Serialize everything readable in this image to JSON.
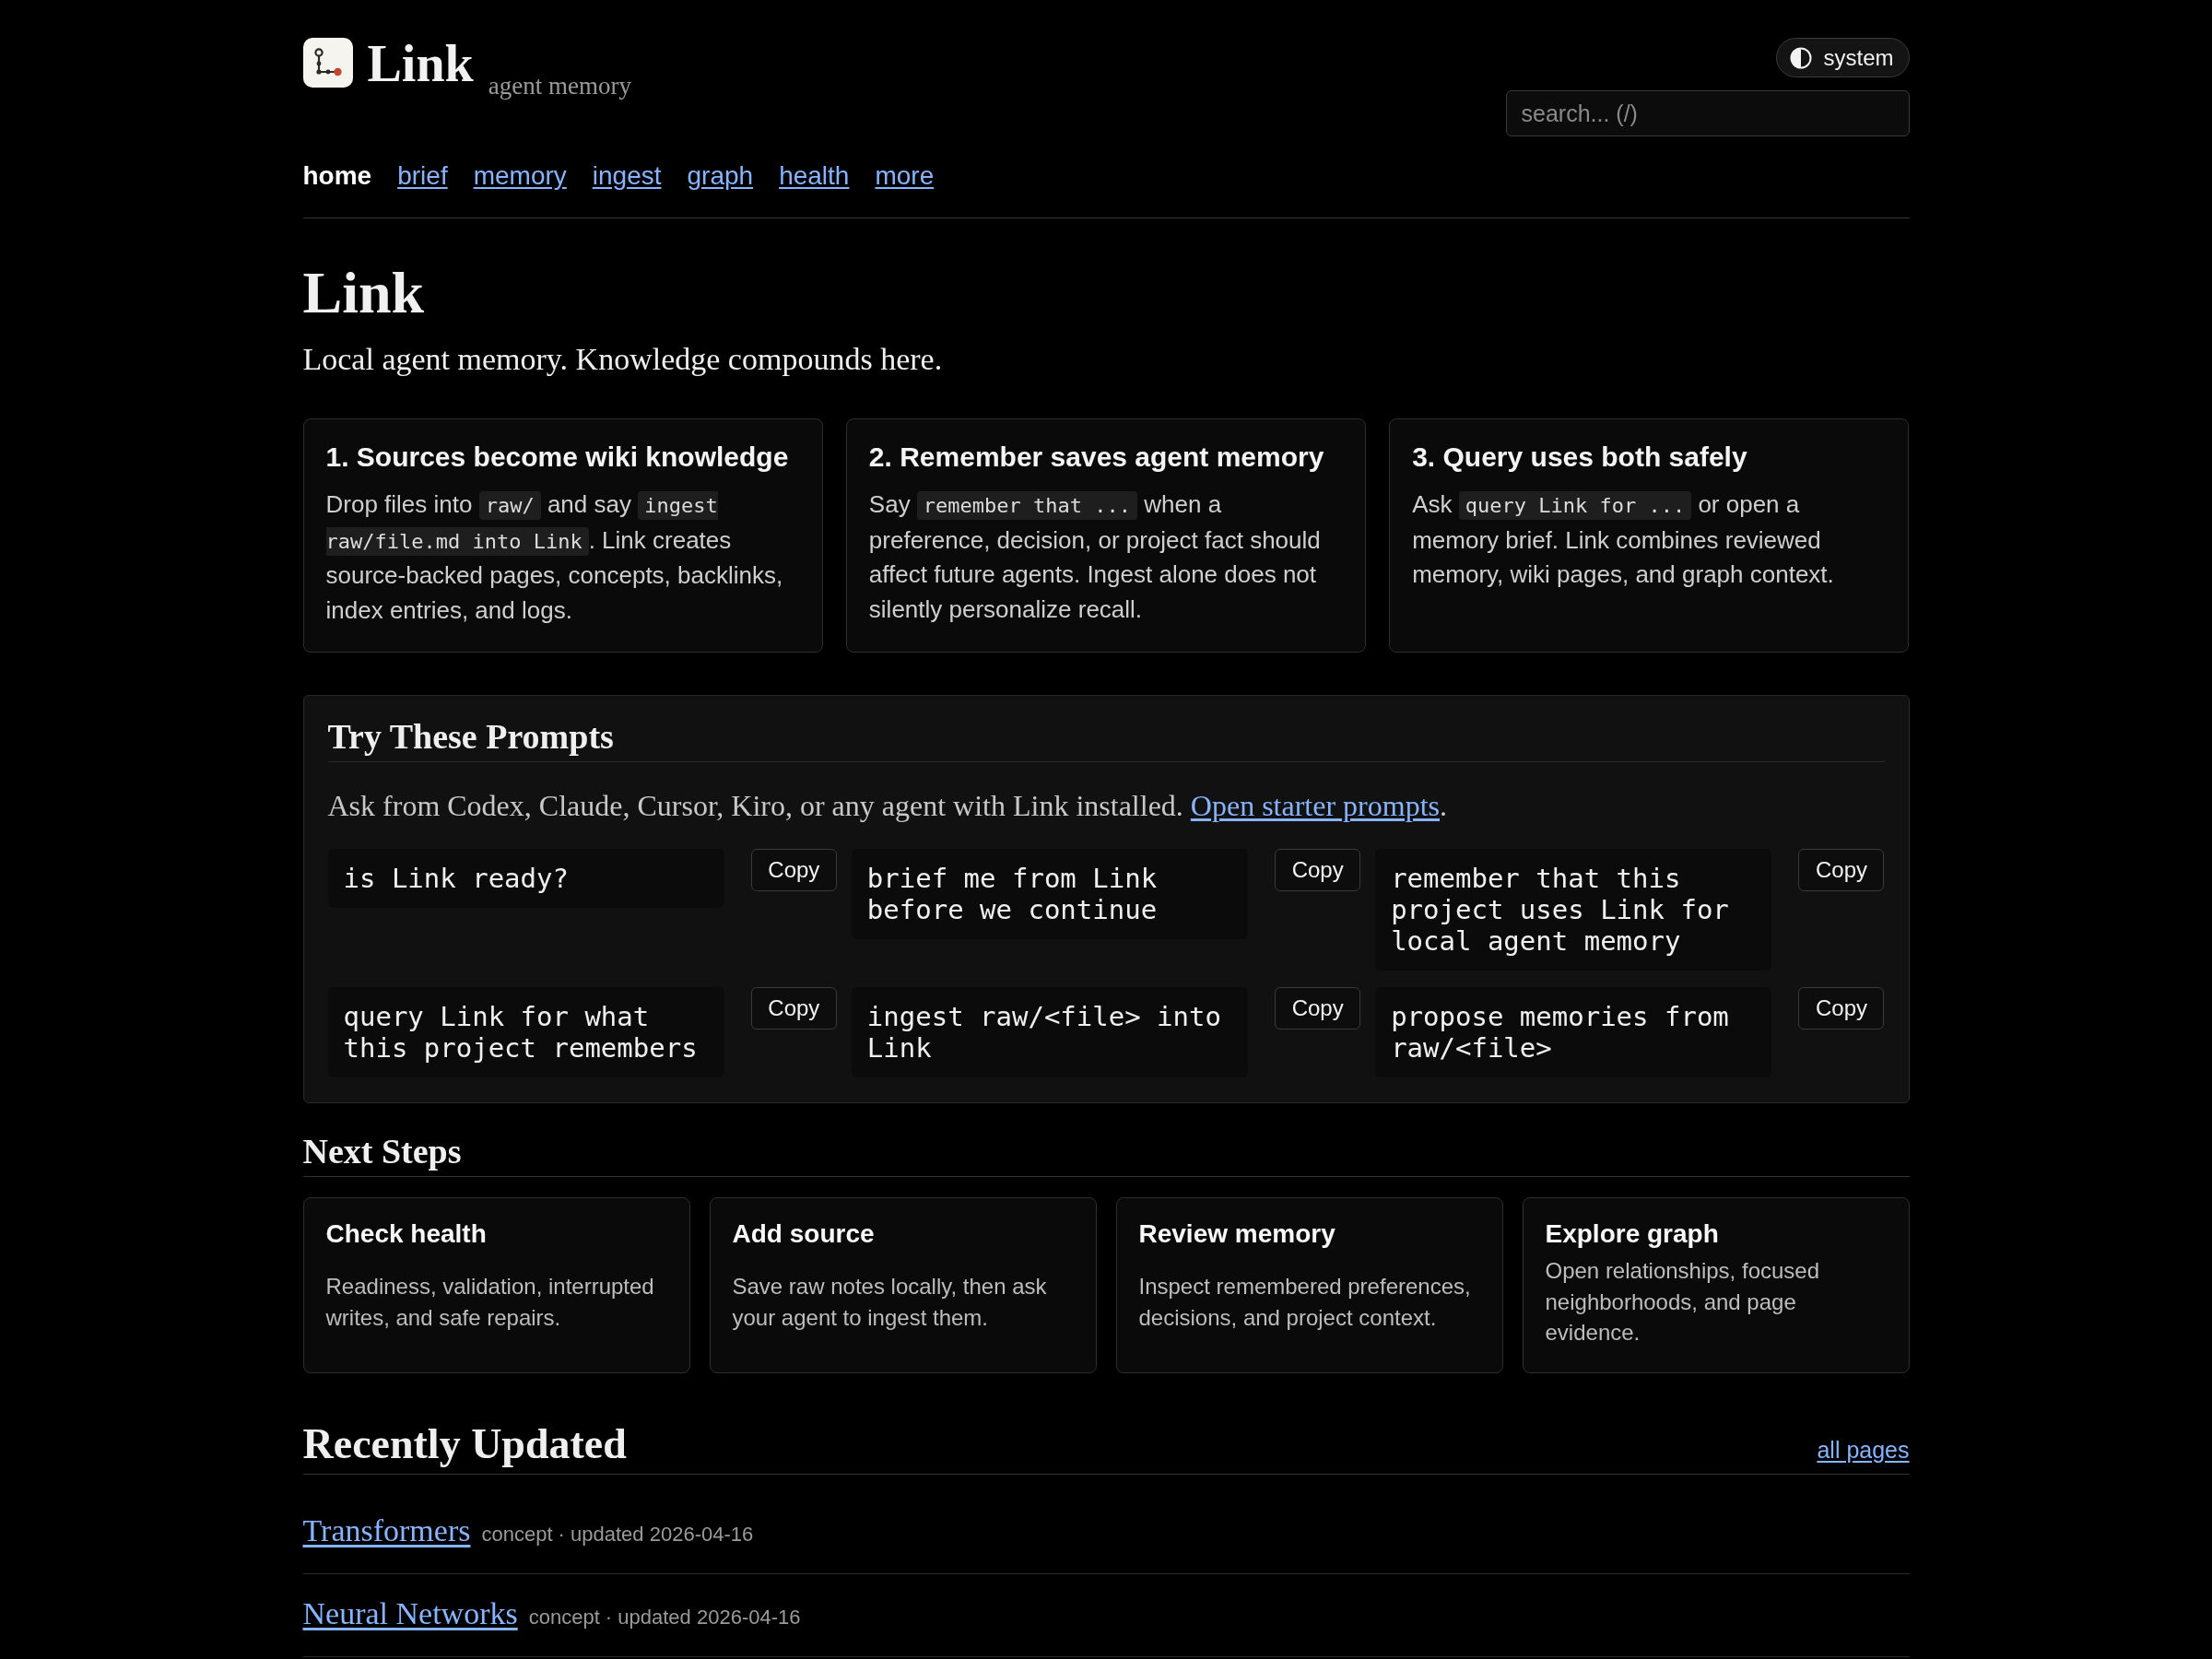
{
  "header": {
    "brand": {
      "title": "Link",
      "subtitle": "agent memory"
    },
    "theme_toggle": {
      "label": "system"
    },
    "search": {
      "placeholder": "search... (/)"
    }
  },
  "nav": [
    {
      "label": "home",
      "selected": true
    },
    {
      "label": "brief",
      "selected": false
    },
    {
      "label": "memory",
      "selected": false
    },
    {
      "label": "ingest",
      "selected": false
    },
    {
      "label": "graph",
      "selected": false
    },
    {
      "label": "health",
      "selected": false
    },
    {
      "label": "more",
      "selected": false
    }
  ],
  "hero": {
    "title": "Link",
    "subtitle": "Local agent memory. Knowledge compounds here."
  },
  "intro_cards": [
    {
      "title": "1. Sources become wiki knowledge",
      "body": [
        {
          "kind": "text",
          "text": "Drop files into "
        },
        {
          "kind": "code",
          "text": "raw/"
        },
        {
          "kind": "text",
          "text": " and say "
        },
        {
          "kind": "code",
          "text": "ingest raw/file.md into Link"
        },
        {
          "kind": "text",
          "text": ". Link creates source-backed pages, concepts, backlinks, index entries, and logs."
        }
      ]
    },
    {
      "title": "2. Remember saves agent memory",
      "body": [
        {
          "kind": "text",
          "text": "Say "
        },
        {
          "kind": "code",
          "text": "remember that ..."
        },
        {
          "kind": "text",
          "text": " when a preference, decision, or project fact should affect future agents. Ingest alone does not silently personalize recall."
        }
      ]
    },
    {
      "title": "3. Query uses both safely",
      "body": [
        {
          "kind": "text",
          "text": "Ask "
        },
        {
          "kind": "code",
          "text": "query Link for ..."
        },
        {
          "kind": "text",
          "text": " or open a memory brief. Link combines reviewed memory, wiki pages, and graph context."
        }
      ]
    }
  ],
  "prompts": {
    "title": "Try These Prompts",
    "description": [
      {
        "kind": "text",
        "text": "Ask from Codex, Claude, Cursor, Kiro, or any agent with Link installed. "
      },
      {
        "kind": "link",
        "text": "Open starter prompts"
      },
      {
        "kind": "text",
        "text": "."
      }
    ],
    "items": [
      {
        "prompt": "is Link ready?",
        "button": "Copy"
      },
      {
        "prompt": "brief me from Link before we continue",
        "button": "Copy"
      },
      {
        "prompt": "remember that this project uses Link for local agent memory",
        "button": "Copy"
      },
      {
        "prompt": "query Link for what this project remembers",
        "button": "Copy"
      },
      {
        "prompt": "ingest raw/<file> into Link",
        "button": "Copy"
      },
      {
        "prompt": "propose memories from raw/<file>",
        "button": "Copy"
      }
    ]
  },
  "next_steps": {
    "title": "Next Steps",
    "cards": [
      {
        "title": "Check health",
        "description": "Readiness, validation, interrupted writes, and safe repairs."
      },
      {
        "title": "Add source",
        "description": "Save raw notes locally, then ask your agent to ingest them."
      },
      {
        "title": "Review memory",
        "description": "Inspect remembered preferences, decisions, and project context."
      },
      {
        "title": "Explore graph",
        "description": "Open relationships, focused neighborhoods, and page evidence."
      }
    ]
  },
  "recently_updated": {
    "title": "Recently Updated",
    "all_link": "all pages",
    "items": [
      {
        "title": "Transformers",
        "meta": "concept · updated 2026-04-16"
      },
      {
        "title": "Neural Networks",
        "meta": "concept · updated 2026-04-16"
      }
    ]
  }
}
